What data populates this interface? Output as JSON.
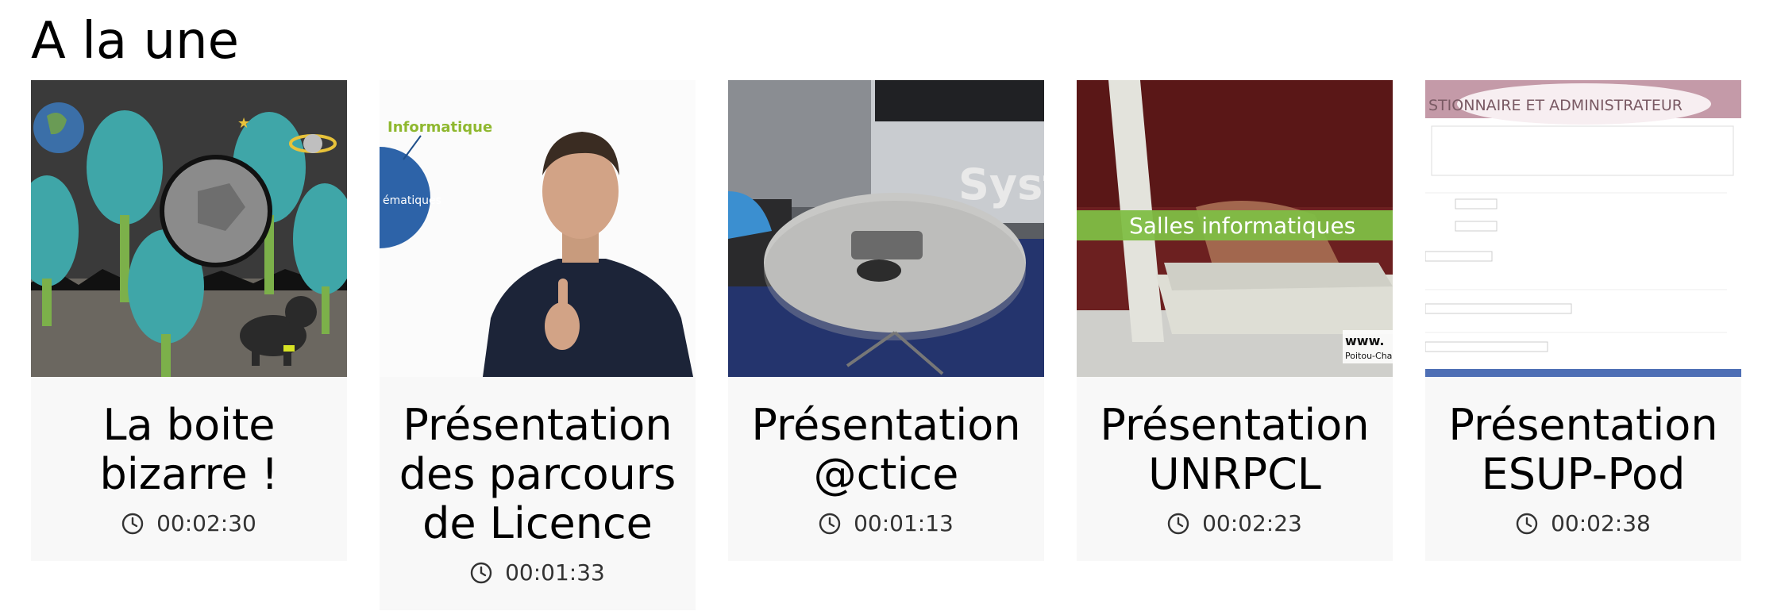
{
  "section": {
    "title": "A la une"
  },
  "cards": [
    {
      "title": "La boite bizarre !",
      "duration": "00:02:30",
      "thumb_icon": "animation-trees-ball-dog-thumbnail"
    },
    {
      "title": "Présentation des parcours de Licence",
      "duration": "00:01:33",
      "thumb_icon": "presenter-video-thumbnail",
      "thumb_text": [
        "Informatique",
        "ématiques"
      ]
    },
    {
      "title": "Présentation @ctice",
      "duration": "00:01:13",
      "thumb_icon": "meeting-table-thumbnail",
      "thumb_text": [
        "Syst"
      ]
    },
    {
      "title": "Présentation UNRPCL",
      "duration": "00:02:23",
      "thumb_icon": "keyboard-typing-thumbnail",
      "thumb_text": [
        "Salles informatiques",
        "www.",
        "Poitou-Chare"
      ]
    },
    {
      "title": "Présentation ESUP-Pod",
      "duration": "00:02:38",
      "thumb_icon": "form-screenshot-thumbnail",
      "thumb_text": [
        "STIONNAIRE ET ADMINISTRATEUR"
      ]
    }
  ],
  "colors": {
    "card_bg": "#f8f8f8",
    "text": "#000000",
    "muted": "#333333"
  }
}
